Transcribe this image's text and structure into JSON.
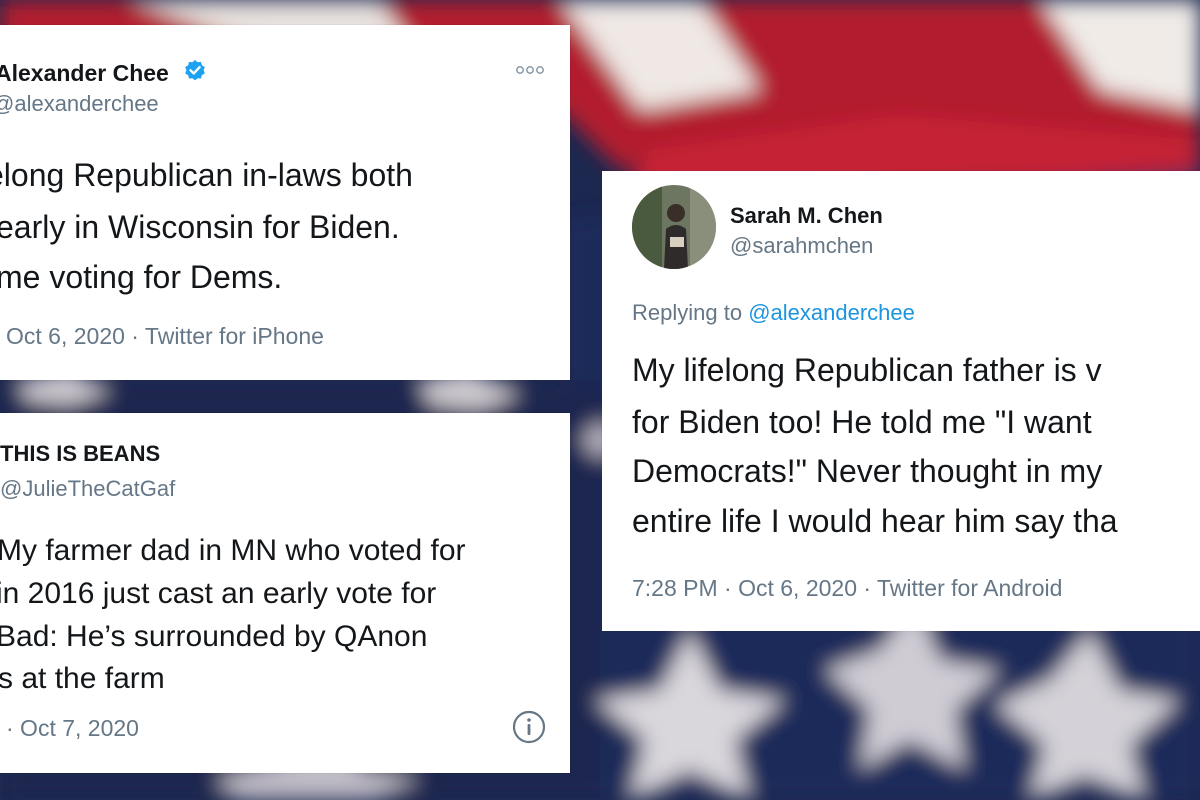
{
  "tweets": [
    {
      "name": "Alexander Chee",
      "handle": "@alexanderchee",
      "lines": [
        "elong Republican in-laws both",
        "early in Wisconsin for Biden.",
        "me voting for Dems."
      ],
      "meta": "Oct 6, 2020 · Twitter for iPhone",
      "icons": [
        "verified-badge-icon",
        "more-options-icon"
      ]
    },
    {
      "name": "THIS IS BEANS",
      "handle": "@JulieTheCatGaf",
      "lines": [
        "My farmer dad in MN who voted for",
        "in 2016 just cast an early vote for",
        "Bad: He’s surrounded by QAnon",
        "s at the farm"
      ],
      "meta": "· Oct 7, 2020",
      "icons": [
        "info-icon"
      ]
    },
    {
      "name": "Sarah M. Chen",
      "handle": "@sarahmchen",
      "reply_prefix": "Replying to",
      "reply_to": "@alexanderchee",
      "lines": [
        "My lifelong Republican father is v",
        "for Biden too! He told me \"I want",
        "Democrats!\" Never thought in my",
        "entire life I would hear him say tha"
      ],
      "meta": "7:28 PM · Oct 6, 2020 · Twitter for Android",
      "icons": [
        "avatar"
      ]
    }
  ],
  "colors": {
    "text": "#14171a",
    "secondary": "#657786",
    "link": "#1b95e0",
    "verified": "#1da1f2",
    "flag_red": "#b3182b",
    "flag_blue": "#1b2a55"
  }
}
